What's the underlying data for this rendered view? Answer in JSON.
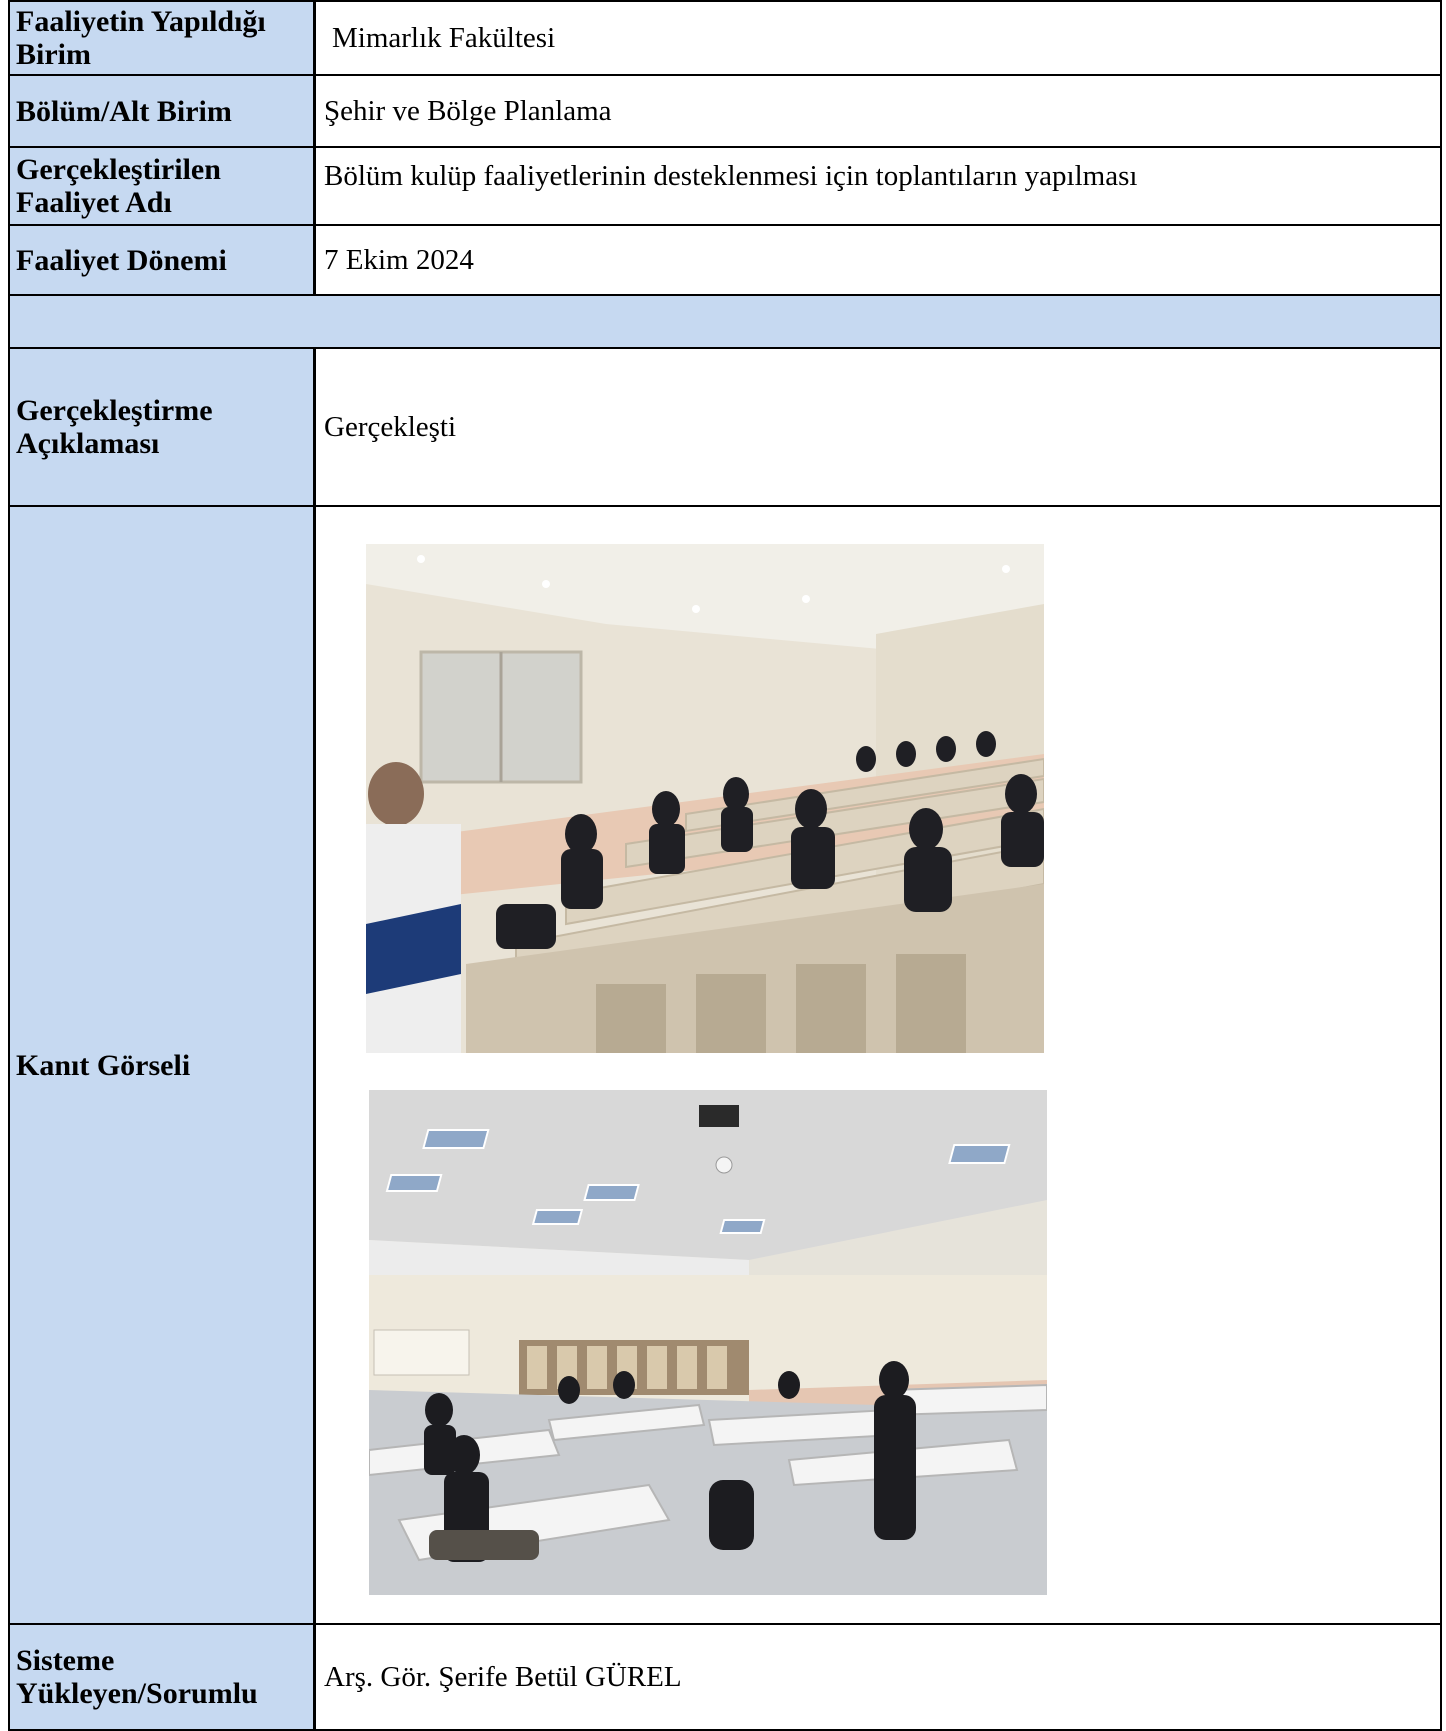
{
  "rows": [
    {
      "label": "Faaliyetin Yapıldığı Birim",
      "value": "Mimarlık Fakültesi"
    },
    {
      "label": "Bölüm/Alt Birim",
      "value": "Şehir ve Bölge Planlama"
    },
    {
      "label": "Gerçekleştirilen Faaliyet Adı",
      "value": "Bölüm kulüp faaliyetlerinin desteklenmesi için toplantıların yapılması"
    },
    {
      "label": "Faaliyet Dönemi",
      "value": "7 Ekim 2024"
    },
    {
      "label": "Gerçekleştirme Açıklaması",
      "value": "Gerçekleşti"
    },
    {
      "label": "Kanıt Görseli"
    },
    {
      "label": "Sisteme Yükleyen/Sorumlu",
      "value": "Arş. Gör. Şerife Betül GÜREL"
    }
  ],
  "photos": [
    {
      "description_id": "lecture-hall-photo"
    },
    {
      "description_id": "classroom-photo"
    }
  ],
  "colors": {
    "label_bg": "#c6d9f1",
    "border": "#000000"
  }
}
